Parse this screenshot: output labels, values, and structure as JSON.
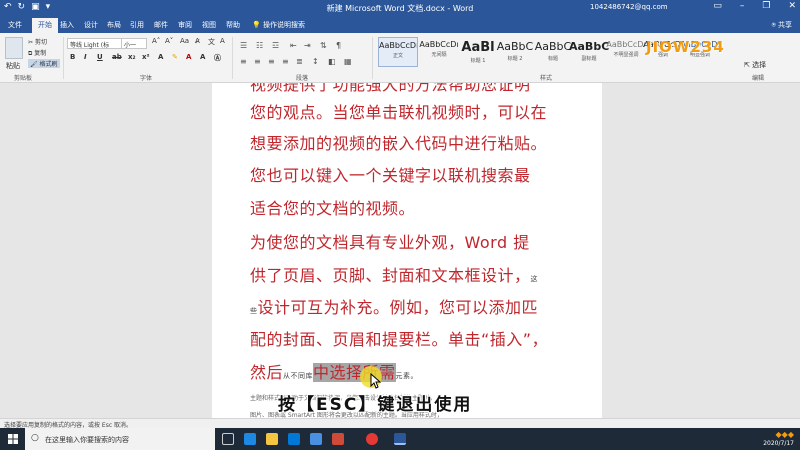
{
  "titlebar": {
    "qat_icons": [
      "save-icon",
      "undo-icon",
      "redo-icon",
      "customize-icon"
    ],
    "title": "新建 Microsoft Word 文档.docx - Word",
    "account": "1042486742@qq.com"
  },
  "tabs": [
    {
      "label": "文件",
      "active": false
    },
    {
      "label": "开始",
      "active": true
    },
    {
      "label": "插入",
      "active": false
    },
    {
      "label": "设计",
      "active": false
    },
    {
      "label": "布局",
      "active": false
    },
    {
      "label": "引用",
      "active": false
    },
    {
      "label": "邮件",
      "active": false
    },
    {
      "label": "审阅",
      "active": false
    },
    {
      "label": "视图",
      "active": false
    },
    {
      "label": "帮助",
      "active": false
    }
  ],
  "tell_me": "操作说明搜索",
  "share": "共享",
  "ribbon": {
    "paste_label": "粘贴",
    "cut_label": "剪切",
    "copy_label": "复制",
    "format_painter_label": "格式刷",
    "clipboard_label": "剪贴板",
    "font_name": "等线 Light (标",
    "font_size": "小一",
    "font_label": "字体",
    "paragraph_label": "段落",
    "styles_label": "样式",
    "styles": [
      {
        "sample": "AaBbCcDı",
        "name": "正文",
        "selected": true
      },
      {
        "sample": "AaBbCcDı",
        "name": "无间隔",
        "selected": false
      },
      {
        "sample": "AaBl",
        "name": "标题 1",
        "selected": false
      },
      {
        "sample": "AaBbC",
        "name": "标题 2",
        "selected": false
      },
      {
        "sample": "AaBbC",
        "name": "标题",
        "selected": false
      },
      {
        "sample": "AaBbC",
        "name": "副标题",
        "selected": false
      },
      {
        "sample": "AaBbCcDı",
        "name": "不明显强调",
        "selected": false
      },
      {
        "sample": "AaBbCcDı",
        "name": "强调",
        "selected": false
      },
      {
        "sample": "AaBbCcDı",
        "name": "明显强调",
        "selected": false
      }
    ],
    "select_label": "选择",
    "editing_label": "编辑"
  },
  "watermark_logo": "JIOW234",
  "document": {
    "lines": [
      "您的观点。当您单击联机视频时，可以在",
      "想要添加的视频的嵌入代码中进行粘贴。",
      "您也可以键入一个关键字以联机搜索最",
      "适合您的文档的视频。",
      "为使您的文档具有专业外观，Word 提",
      "供了页眉、页脚、封面和文本框设计，"
    ],
    "line7_small_pre": "些",
    "line7_main": "设计可互为补充。例如，您可以添加匹",
    "line6_small_tail": "这",
    "line8": "配的封面、页眉和提要栏。单击“插入”，",
    "line9_main_pre": "然后",
    "line9_small": "从不同库",
    "line9_highlight": "中选择所需",
    "line9_small_tail": "元素。",
    "faint_line1": "主题和样式也有助于文档保持协调。当您单击设计并选择新的主题时，",
    "faint_line2": "图片、图表或 SmartArt 图形将会更改以匹配新的主题。当应用样式时，"
  },
  "caption": "按【ESC】键退出使用",
  "statusbar": "选择要应用复制的格式的内容，或按 Esc 取消。",
  "taskbar": {
    "search_placeholder": "在这里输入你要搜索的内容",
    "date": "2020/7/17",
    "icons": [
      "task-view-icon",
      "edge-icon",
      "file-explorer-icon",
      "store-icon",
      "mail-icon",
      "record-icon",
      "app-icon",
      "word-icon"
    ]
  },
  "colors": {
    "word_blue": "#2b579a",
    "doc_text": "#c0272d",
    "highlight": "#a6a6a6"
  }
}
